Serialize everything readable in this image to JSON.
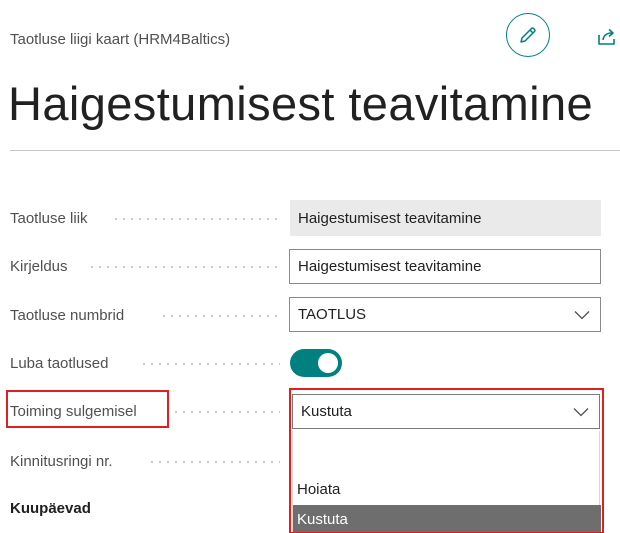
{
  "header": {
    "breadcrumb": "Taotluse liigi kaart (HRM4Baltics)",
    "title": "Haigestumisest teavitamine",
    "edit_icon": "pencil-icon",
    "share_icon": "share-icon",
    "accent_color": "#00807e"
  },
  "fields": {
    "taotluse_liik": {
      "label": "Taotluse liik",
      "value": "Haigestumisest teavitamine"
    },
    "kirjeldus": {
      "label": "Kirjeldus",
      "value": "Haigestumisest teavitamine"
    },
    "taotluse_numbrid": {
      "label": "Taotluse numbrid",
      "value": "TAOTLUS"
    },
    "luba_taotlused": {
      "label": "Luba taotlused",
      "enabled": true
    },
    "toiming_sulgemisel": {
      "label": "Toiming sulgemisel",
      "value": "Kustuta"
    },
    "kinnitusringi_nr": {
      "label": "Kinnitusringi nr."
    }
  },
  "dropdown": {
    "options": [
      "Hoiata",
      "Kustuta"
    ],
    "selected": "Kustuta"
  },
  "sections": {
    "kuupaevad": "Kuupäevad"
  },
  "highlight_color": "#e02020"
}
